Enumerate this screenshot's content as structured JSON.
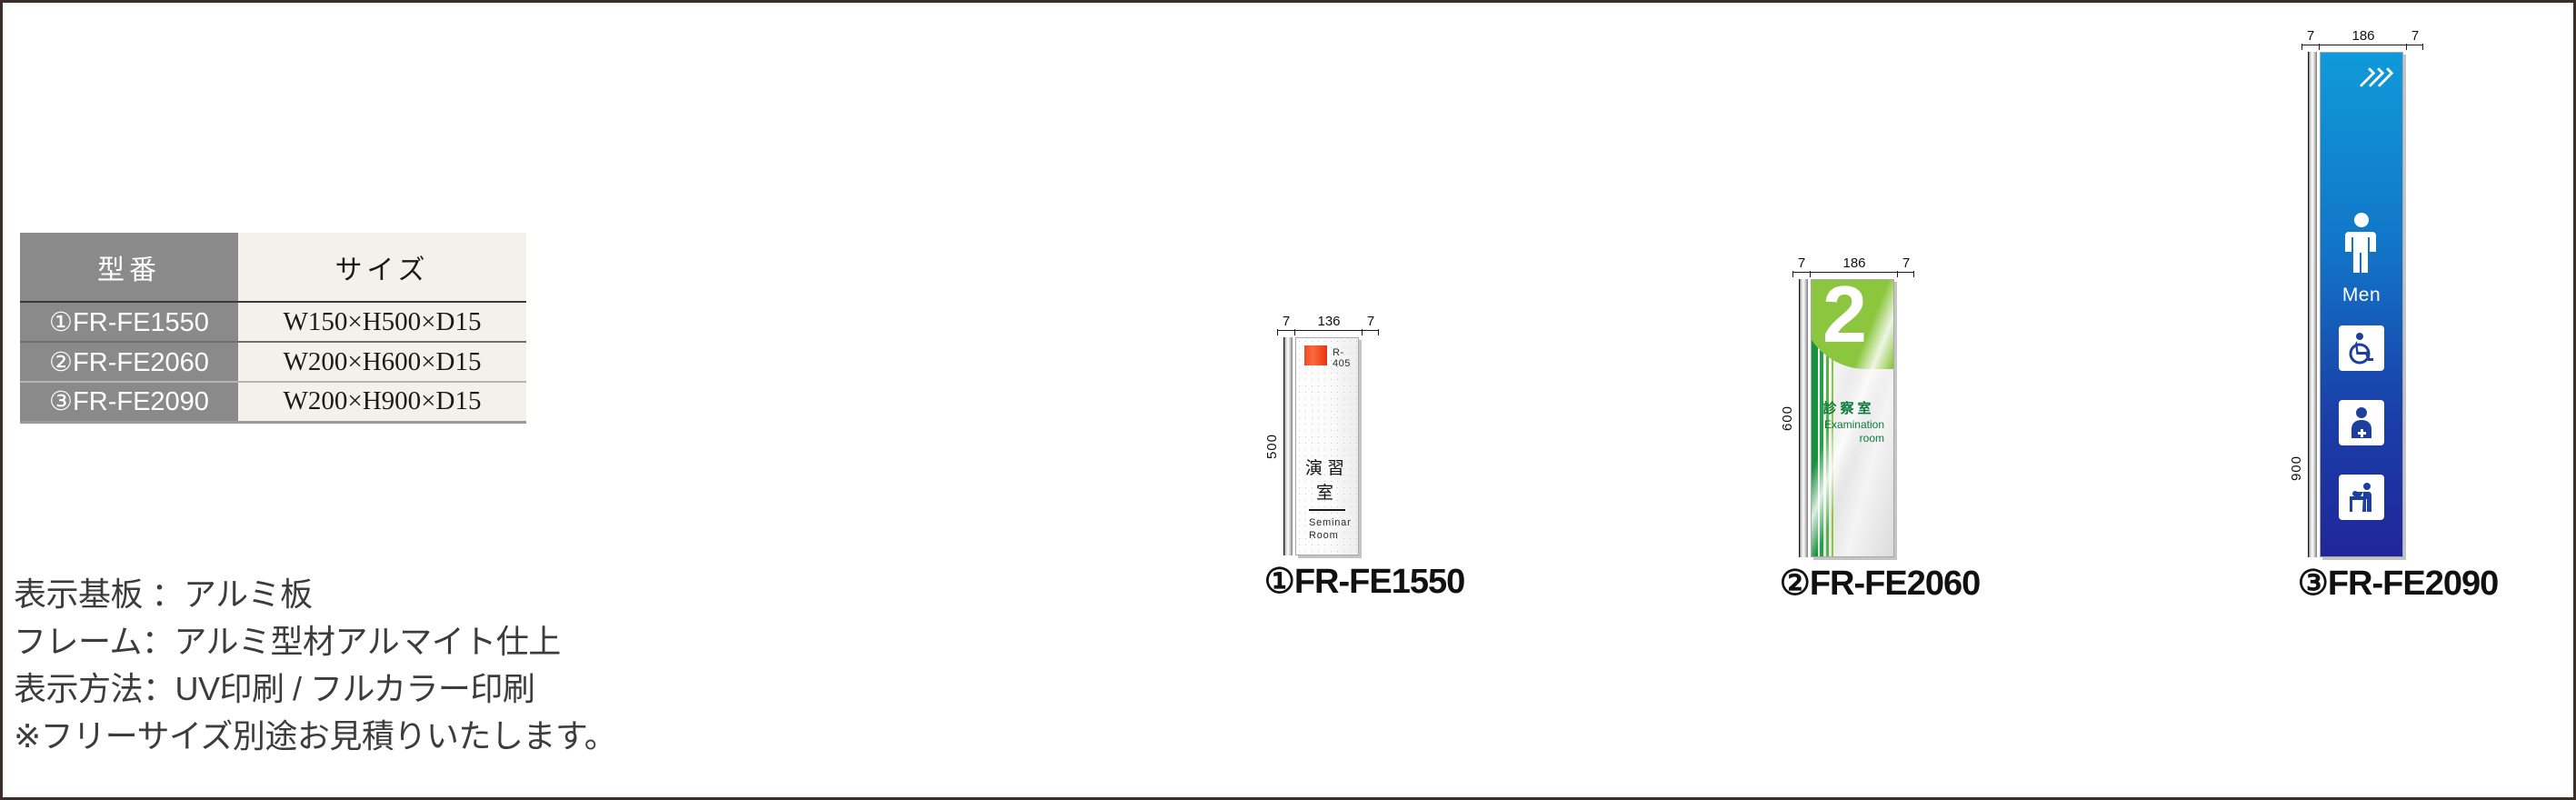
{
  "spec_table": {
    "headers": [
      "型番",
      "サイズ"
    ],
    "rows": [
      {
        "model": "①FR-FE1550",
        "size": "W150×H500×D15"
      },
      {
        "model": "②FR-FE2060",
        "size": "W200×H600×D15"
      },
      {
        "model": "③FR-FE2090",
        "size": "W200×H900×D15"
      }
    ]
  },
  "spec_notes": [
    "表示基板 ：アルミ板",
    "フレーム：アルミ型材アルマイト仕上",
    "表示方法：UV印刷 / フルカラー印刷",
    "※フリーサイズ別途お見積りいたします。"
  ],
  "signs": [
    {
      "caption": "①FR-FE1550",
      "dim_left": "7",
      "dim_center": "136",
      "dim_right": "7",
      "dim_height": "500",
      "color_code": "R-405",
      "title_jp": "演習室",
      "title_en_line1": "Seminar",
      "title_en_line2": "Room",
      "swatch_color": "#ef4a22"
    },
    {
      "caption": "②FR-FE2060",
      "dim_left": "7",
      "dim_center": "186",
      "dim_right": "7",
      "dim_height": "600",
      "floor_number": "2",
      "title_jp": "診察室",
      "title_en_line1": "Examination",
      "title_en_line2": "room",
      "accent_color": "#8cc63e",
      "text_color": "#0d7a3c"
    },
    {
      "caption": "③FR-FE2090",
      "dim_left": "7",
      "dim_center": "186",
      "dim_right": "7",
      "dim_height": "900",
      "label": "Men",
      "icons": [
        "chevron-arrows-icon",
        "man-pictogram-icon",
        "wheelchair-accessible-icon",
        "ostomate-icon",
        "baby-changing-icon"
      ],
      "accent_color": "#1276c8"
    }
  ]
}
